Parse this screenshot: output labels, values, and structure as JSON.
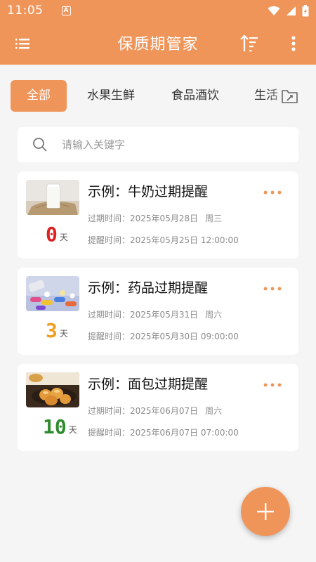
{
  "status_bar": {
    "time": "11:05",
    "notification_glyph": "A",
    "icons": [
      "wifi-icon",
      "cell-signal-icon",
      "battery-icon"
    ]
  },
  "app_bar": {
    "title": "保质期管家",
    "icons": [
      "menu-icon",
      "sort-icon",
      "more-vert-icon"
    ]
  },
  "tabs": [
    {
      "label": "全部",
      "active": true
    },
    {
      "label": "水果生鲜",
      "active": false
    },
    {
      "label": "食品酒饮",
      "active": false
    },
    {
      "label": "生活",
      "active": false
    }
  ],
  "search": {
    "placeholder": "请输入关键字"
  },
  "items": [
    {
      "name": "示例：牛奶过期提醒",
      "expire_label": "过期时间：",
      "expire_date": "2025年05月28日",
      "expire_weekday": "周三",
      "remind_label": "提醒时间：",
      "remind_datetime": "2025年05月25日 12:00:00",
      "days_left": "0",
      "days_unit": "天",
      "days_color": "#e02020",
      "image": "milk-photo"
    },
    {
      "name": "示例：药品过期提醒",
      "expire_label": "过期时间：",
      "expire_date": "2025年05月31日",
      "expire_weekday": "周六",
      "remind_label": "提醒时间：",
      "remind_datetime": "2025年05月30日 09:00:00",
      "days_left": "3",
      "days_unit": "天",
      "days_color": "#f0a020",
      "image": "pills-photo"
    },
    {
      "name": "示例：面包过期提醒",
      "expire_label": "过期时间：",
      "expire_date": "2025年06月07日",
      "expire_weekday": "周六",
      "remind_label": "提醒时间：",
      "remind_datetime": "2025年06月07日 07:00:00",
      "days_left": "10",
      "days_unit": "天",
      "days_color": "#2e8b2e",
      "image": "bread-photo"
    }
  ],
  "colors": {
    "accent": "#f0955a",
    "background": "#f5f5f5"
  }
}
